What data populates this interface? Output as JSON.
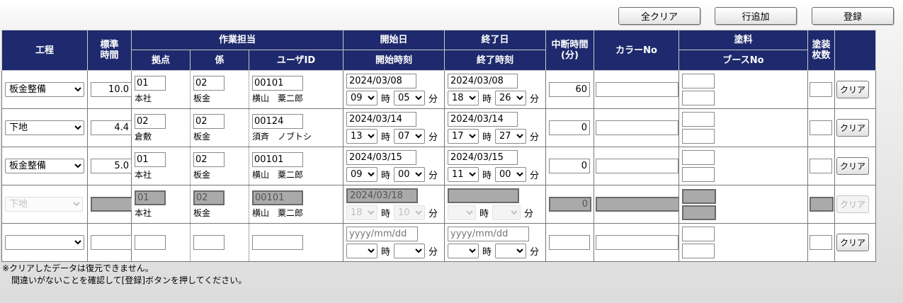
{
  "toolbar": {
    "clear_all": "全クリア",
    "add_row": "行追加",
    "register": "登録"
  },
  "headers": {
    "process": "工程",
    "std_time_1": "標準",
    "std_time_2": "時間",
    "worker": "作業担当",
    "base": "拠点",
    "section": "係",
    "user_id": "ユーザID",
    "start_date": "開始日",
    "start_time": "開始時刻",
    "end_date": "終了日",
    "end_time": "終了時刻",
    "break_1": "中断時間",
    "break_2": "(分)",
    "color_no": "カラーNo",
    "paint": "塗料",
    "booth_no": "ブースNo",
    "coat_1": "塗装",
    "coat_2": "枚数"
  },
  "labels": {
    "hour": "時",
    "minute": "分",
    "clear": "クリア",
    "date_placeholder": "yyyy/mm/dd"
  },
  "rows": [
    {
      "process": "板金整備",
      "std": "10.0",
      "base_code": "01",
      "base_name": "本社",
      "sec_code": "02",
      "sec_name": "板金",
      "user_id": "00101",
      "user_name": "横山　粟二郎",
      "start_date": "2024/03/08",
      "start_h": "09",
      "start_m": "05",
      "end_date": "2024/03/08",
      "end_h": "18",
      "end_m": "26",
      "break": "60"
    },
    {
      "process": "下地",
      "std": "4.4",
      "base_code": "02",
      "base_name": "倉敷",
      "sec_code": "02",
      "sec_name": "板金",
      "user_id": "00124",
      "user_name": "須斉　ノブトシ",
      "start_date": "2024/03/14",
      "start_h": "13",
      "start_m": "07",
      "end_date": "2024/03/14",
      "end_h": "17",
      "end_m": "27",
      "break": "0"
    },
    {
      "process": "板金整備",
      "std": "5.0",
      "base_code": "01",
      "base_name": "本社",
      "sec_code": "02",
      "sec_name": "板金",
      "user_id": "00101",
      "user_name": "横山　粟二郎",
      "start_date": "2024/03/15",
      "start_h": "09",
      "start_m": "00",
      "end_date": "2024/03/15",
      "end_h": "11",
      "end_m": "00",
      "break": "0"
    },
    {
      "process": "下地",
      "std": "",
      "base_code": "01",
      "base_name": "本社",
      "sec_code": "02",
      "sec_name": "板金",
      "user_id": "00101",
      "user_name": "横山　粟二郎",
      "start_date": "2024/03/18",
      "start_h": "18",
      "start_m": "10",
      "end_date": "",
      "end_h": "",
      "end_m": "",
      "break": "0"
    }
  ],
  "notes": {
    "line1": "※クリアしたデータは復元できません。",
    "line2": "間違いがないことを確認して[登録]ボタンを押してください。"
  }
}
